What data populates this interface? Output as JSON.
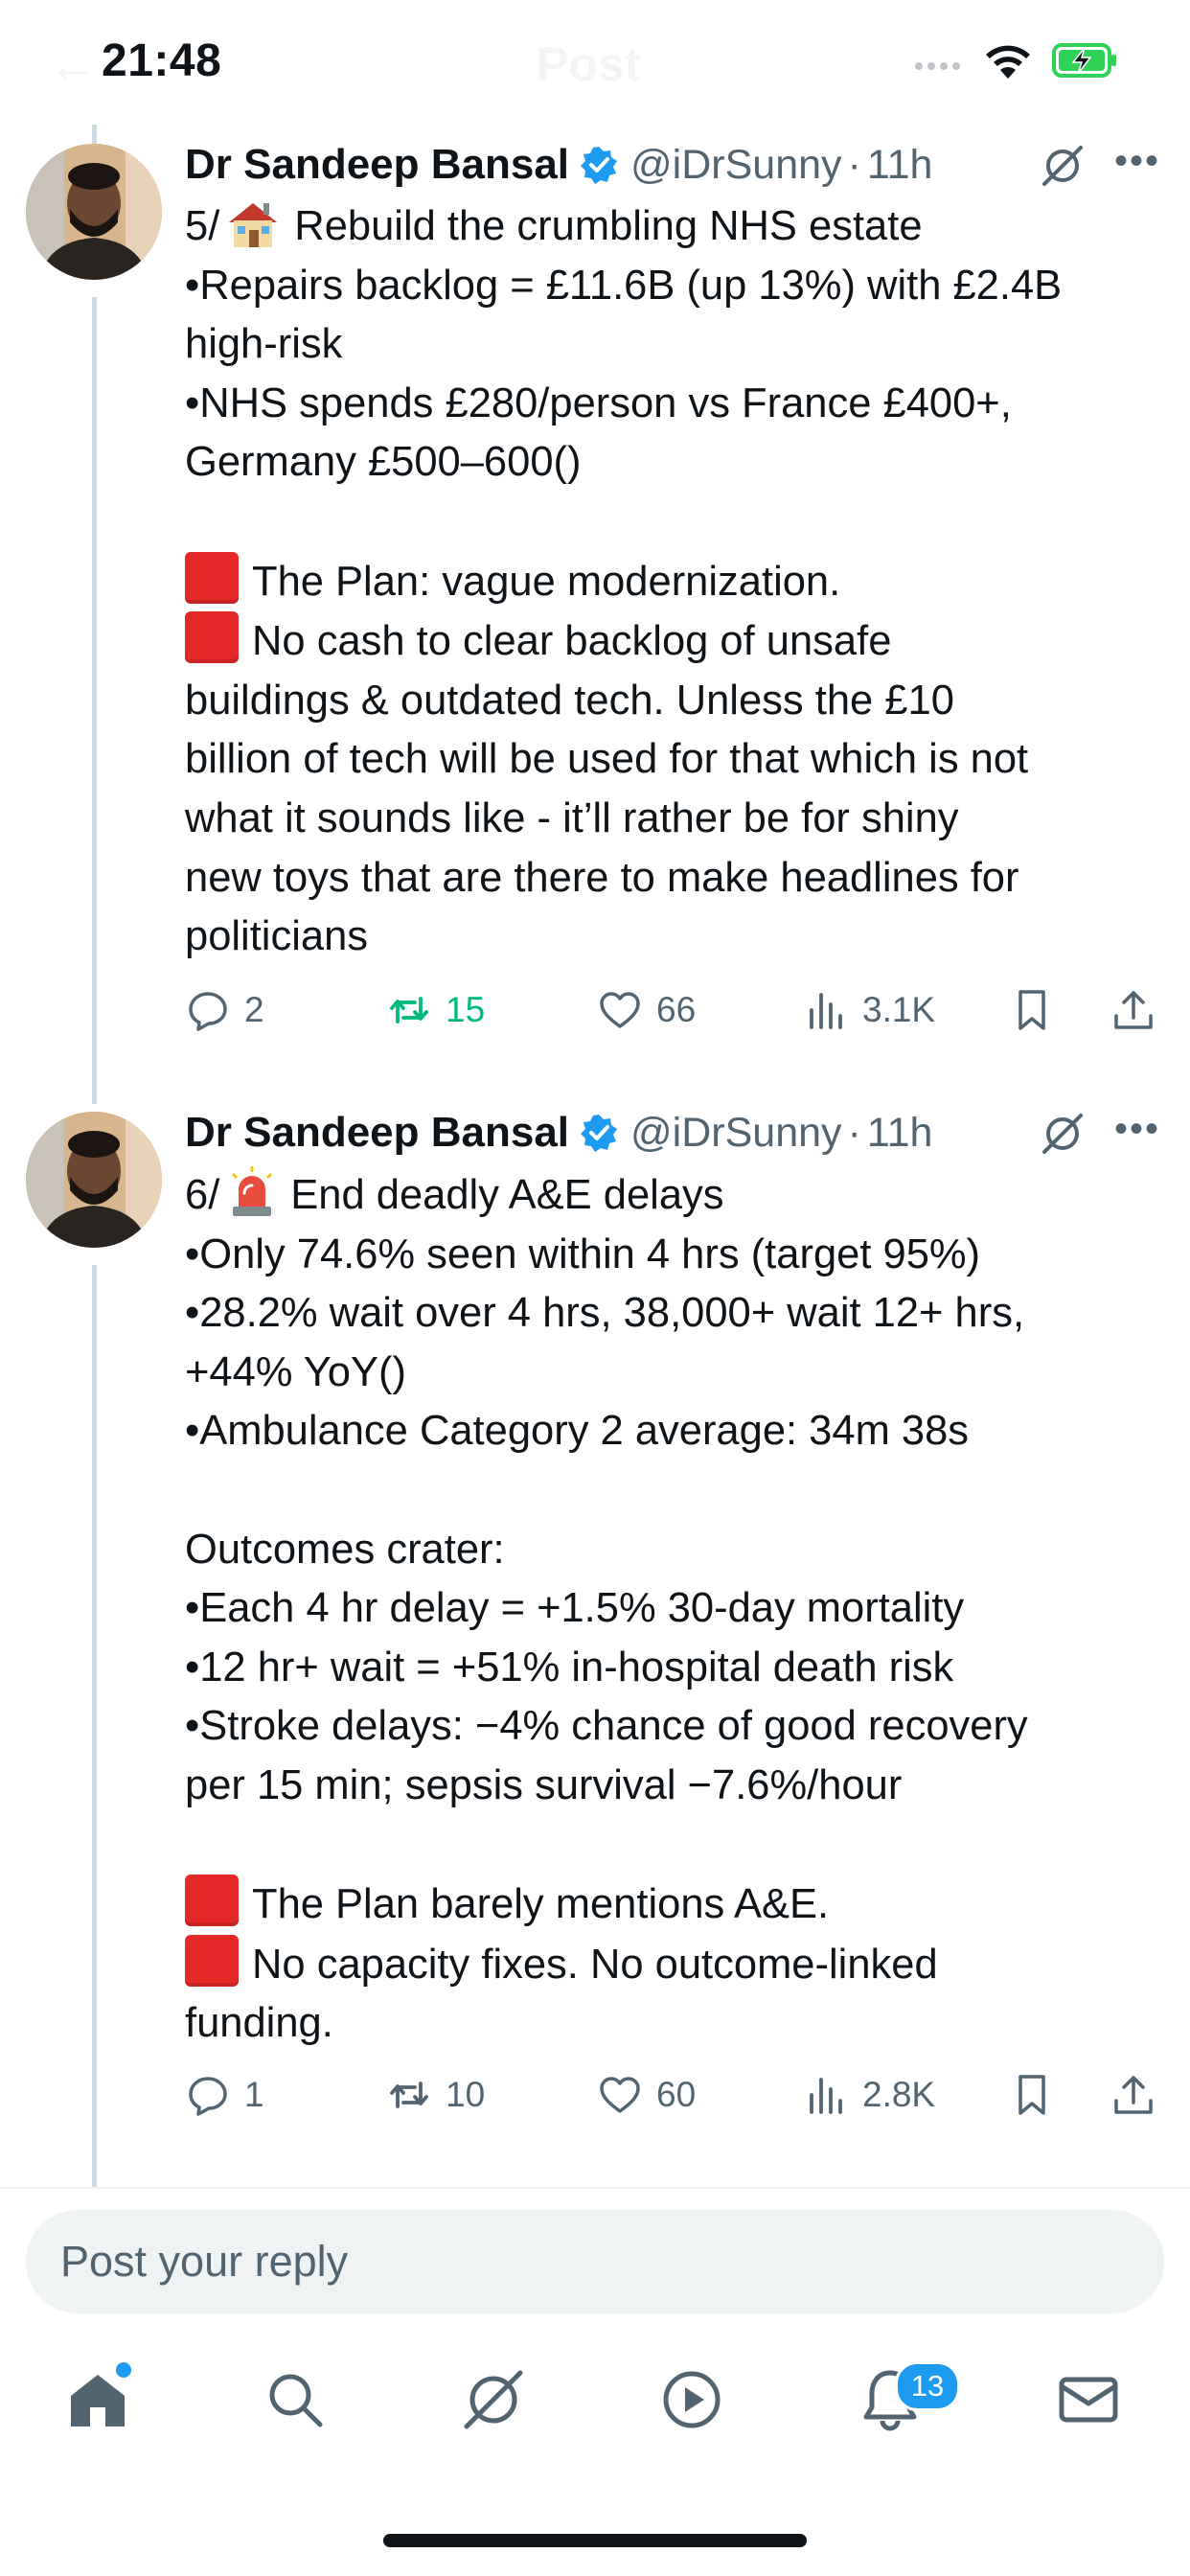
{
  "status_bar": {
    "time": "21:48",
    "ghost_title": "Post"
  },
  "colors": {
    "accent": "#1d9bf0",
    "retweet_active": "#00ba7c",
    "text": "#0f1419",
    "secondary": "#536471",
    "red_square": "#e52929"
  },
  "tweets": [
    {
      "author": {
        "name": "Dr Sandeep Bansal",
        "handle": "@iDrSunny",
        "time": "11h",
        "verified": true
      },
      "intro_prefix": "5/",
      "intro_emoji": "house-with-garden-icon",
      "intro_text": "Rebuild the crumbling NHS estate",
      "paragraph1": "•Repairs backlog = £11.6B (up 13%) with £2.4B\nhigh-risk\n•NHS spends £280/person vs France £400+,\nGermany £500–600()",
      "red_line_1": "The Plan: vague modernization.",
      "red_line_2": "No cash to clear backlog of unsafe",
      "paragraph2": "buildings & outdated tech. Unless the £10\nbillion of tech will be used for that which is not\nwhat it sounds like - it’ll rather be for shiny\nnew toys that are there to make headlines for\npoliticians",
      "stats": {
        "replies": "2",
        "retweets": "15",
        "likes": "66",
        "views": "3.1K",
        "retweeted": true
      }
    },
    {
      "author": {
        "name": "Dr Sandeep Bansal",
        "handle": "@iDrSunny",
        "time": "11h",
        "verified": true
      },
      "intro_prefix": "6/",
      "intro_emoji": "police-siren-icon",
      "intro_text": "End deadly A&E delays",
      "paragraph1": "•Only 74.6% seen within 4 hrs (target 95%)\n•28.2% wait over 4 hrs, 38,000+ wait 12+ hrs,\n+44% YoY()\n•Ambulance Category 2 average: 34m 38s\n\nOutcomes crater:\n•Each 4 hr delay = +1.5% 30-day mortality\n•12 hr+ wait = +51% in-hospital death risk\n•Stroke delays: −4% chance of good recovery\nper 15 min; sepsis survival −7.6%/hour",
      "red_line_1": "The Plan barely mentions A&E.",
      "red_line_2": "No capacity fixes. No outcome-linked",
      "paragraph2": "funding.",
      "stats": {
        "replies": "1",
        "retweets": "10",
        "likes": "60",
        "views": "2.8K",
        "retweeted": false
      }
    }
  ],
  "reply": {
    "placeholder": "Post your reply"
  },
  "bottom_nav": {
    "items": [
      "home-icon",
      "search-icon",
      "grok-icon",
      "video-icon",
      "notifications-icon",
      "messages-icon"
    ],
    "notification_count": "13"
  }
}
